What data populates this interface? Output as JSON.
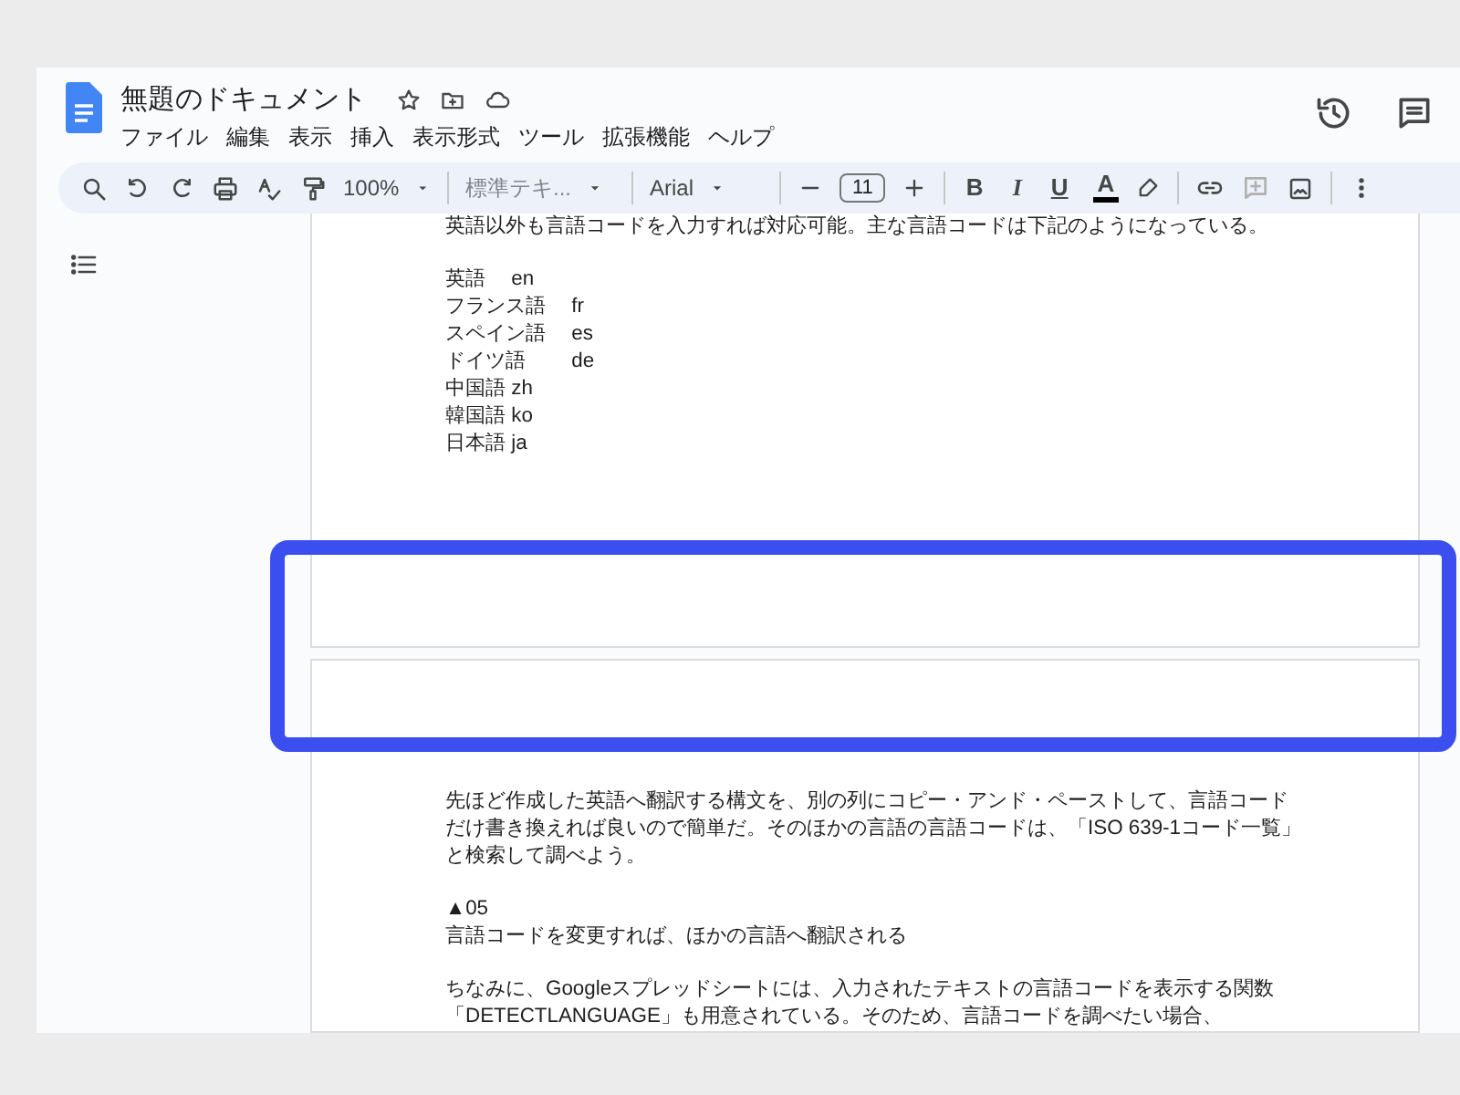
{
  "document": {
    "title": "無題のドキュメント"
  },
  "menu": [
    "ファイル",
    "編集",
    "表示",
    "挿入",
    "表示形式",
    "ツール",
    "拡張機能",
    "ヘルプ"
  ],
  "toolbar": {
    "zoom": "100%",
    "style": "標準テキ...",
    "font": "Arial",
    "font_size": "11",
    "format_buttons": [
      {
        "kind": "bold",
        "label": "B"
      },
      {
        "kind": "italic",
        "label": "I"
      },
      {
        "kind": "underline",
        "label": "U"
      },
      {
        "kind": "text_color",
        "label": "A"
      }
    ]
  },
  "pages": [
    {
      "paragraphs": [
        [
          "英語以外も言語コードを入力すれば対応可能。主な言語コードは下記のようになっている。"
        ],
        [
          "英語　 en",
          "フランス語　 fr",
          "スペイン語　 es",
          "ドイツ語　　 de",
          "中国語 zh",
          "韓国語 ko",
          "日本語 ja"
        ]
      ]
    },
    {
      "paragraphs": [
        [
          "先ほど作成した英語へ翻訳する構文を、別の列にコピー・アンド・ペーストして、言語コードだけ書き換えれば良いので簡単だ。そのほかの言語の言語コードは、「ISO 639-1コード一覧」と検索して調べよう。"
        ],
        [
          "▲05",
          "言語コードを変更すれば、ほかの言語へ翻訳される"
        ],
        [
          "ちなみに、Googleスプレッドシートには、入力されたテキストの言語コードを表示する関数「DETECTLANGUAGE」も用意されている。そのため、言語コードを調べたい場合、"
        ]
      ]
    }
  ]
}
